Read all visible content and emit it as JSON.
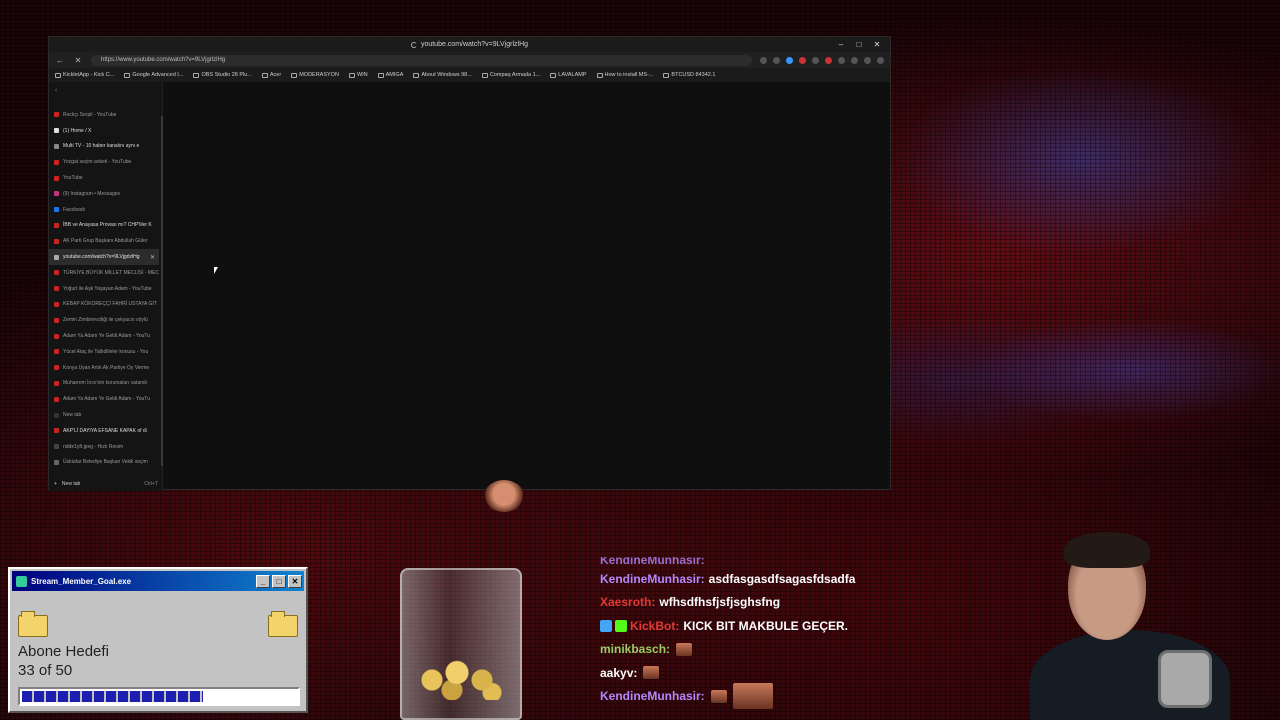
{
  "browser": {
    "title": "youtube.com/watch?v=9LVjgrlzlHg",
    "url": "https://www.youtube.com/watch?v=9LVjgrlzlHg",
    "window_controls": [
      "–",
      "□",
      "✕"
    ],
    "bookmarks": [
      "KickletApp - Kick C...",
      "Google Advanced I...",
      "OBS Studio 28 Plu...",
      "Acer",
      "MODERASYON",
      "WIN",
      "AMIGA",
      "About Windows 98...",
      "Compaq Armada 1...",
      "LAVALAMP",
      "How to install MS-...",
      "BTCUSD 84342.1"
    ],
    "tabs": [
      {
        "title": "Rockçı Serpil - YouTube",
        "color": "#cc2222",
        "state": "dim"
      },
      {
        "title": "(1) Home / X",
        "color": "#dddddd",
        "state": "bright"
      },
      {
        "title": "Multi TV - 10 haber kanalını aynı e",
        "color": "#888888",
        "state": "bright"
      },
      {
        "title": "Yozgat seçim anketi - YouTube",
        "color": "#cc2222",
        "state": "dim"
      },
      {
        "title": "YouTube",
        "color": "#cc2222",
        "state": "dim"
      },
      {
        "title": "(9) Instagram • Messages",
        "color": "#c13584",
        "state": "dim"
      },
      {
        "title": "Facebook",
        "color": "#1877f2",
        "state": "dim"
      },
      {
        "title": "İBB ve Anayasa Provası mı? CHP'liler K",
        "color": "#cc2222",
        "state": "bright"
      },
      {
        "title": "AK Parti Grup Başkanı Abdullah Güler",
        "color": "#cc2222",
        "state": "dim"
      },
      {
        "title": "youtube.com/watch?v=9LVjgrlzlHg",
        "color": "#aaaaaa",
        "state": "active"
      },
      {
        "title": "TÜRKİYE BÜYÜK MİLLET MECLİSİ - MEC",
        "color": "#cc2222",
        "state": "dim"
      },
      {
        "title": "Yoğurt ile Aşk Yaşayan Adam - YouTube",
        "color": "#cc2222",
        "state": "dim"
      },
      {
        "title": "KEBAP KÖKOREÇÇİ FAHRİ USTAYA GİT",
        "color": "#cc2222",
        "state": "dim"
      },
      {
        "title": "Zemin Zimbirevciliği ile çekyacın söylü",
        "color": "#cc2222",
        "state": "dim"
      },
      {
        "title": "Adam Ya Adam Ye Geldi Adam - YouTu",
        "color": "#cc2222",
        "state": "dim"
      },
      {
        "title": "Yücel Ataç ile Tatlıdilleler konusu - You",
        "color": "#cc2222",
        "state": "dim"
      },
      {
        "title": "Konya Uyan Artık Ak Partiye Oy Verme",
        "color": "#cc2222",
        "state": "dim"
      },
      {
        "title": "Muharrem İnce'nin korumaları vatandı",
        "color": "#cc2222",
        "state": "dim"
      },
      {
        "title": "Adam Ya Adam Ye Geldi Adam - YouTu",
        "color": "#cc2222",
        "state": "dim"
      },
      {
        "title": "New tab",
        "color": "#333333",
        "state": "dim"
      },
      {
        "title": "AKP'Lİ DAYIYA EFSANE KAPAK of di",
        "color": "#cc2222",
        "state": "bright"
      },
      {
        "title": "ndde1yft.jpeg - Hızlı Resim",
        "color": "#444444",
        "state": "dim"
      },
      {
        "title": "Üsküdar Belediye Başkan Vekili seçim",
        "color": "#666666",
        "state": "dim"
      }
    ],
    "new_tab_label": "New tab",
    "new_tab_shortcut": "Ctrl+T"
  },
  "goal_widget": {
    "title": "Stream_Member_Goal.exe",
    "label": "Abone Hedefi",
    "count_text": "33 of 50",
    "progress_fraction": 0.66,
    "buttons": [
      "_",
      "□",
      "✕"
    ]
  },
  "chat": {
    "partial_top": "KendineMunhasir:",
    "messages": [
      {
        "user": "KendineMunhasir:",
        "color": "#b388ff",
        "text": "asdfasgasdfsagasfdsadfa",
        "emote": false
      },
      {
        "user": "Xaesroth:",
        "color": "#e53935",
        "text": "wfhsdfhsfjsfjsghsfng",
        "emote": false
      },
      {
        "user": "KickBot:",
        "color": "#e53935",
        "text": "KICK BIT MAKBULE GEÇER.",
        "emote": false,
        "badges": true
      },
      {
        "user": "minikbasch:",
        "color": "#9ccc65",
        "text": "",
        "emote": true
      },
      {
        "user": "aakyv:",
        "color": "#ffffff",
        "text": "",
        "emote": true
      },
      {
        "user": "KendineMunhasir:",
        "color": "#b388ff",
        "text": "",
        "emote": true,
        "wide": true
      }
    ]
  },
  "icons": {
    "back": "←",
    "reload": "✕",
    "close": "✕",
    "collapse": "‹",
    "plus": "+"
  }
}
